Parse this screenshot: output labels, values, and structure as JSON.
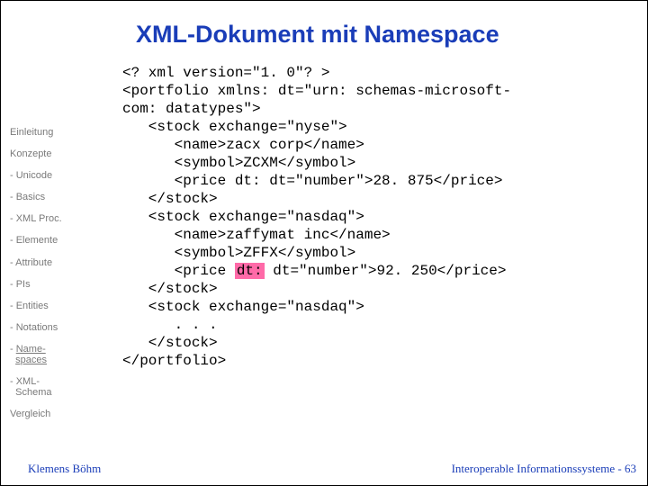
{
  "title": "XML-Dokument mit Namespace",
  "sidebar": {
    "items": [
      "Einleitung",
      "Konzepte",
      "- Unicode",
      "- Basics",
      "- XML Proc.",
      "- Elemente",
      "- Attribute",
      "- PIs",
      "- Entities",
      "- Notations"
    ],
    "active_prefix": "- ",
    "active_link_1": "Name-",
    "active_link_2": "spaces",
    "schema_1": "- XML-",
    "schema_2": "Schema",
    "last": "Vergleich"
  },
  "code": {
    "l1": "<? xml version=\"1. 0\"? >",
    "l2": "<portfolio xmlns: dt=\"urn: schemas-microsoft-",
    "l3": "com: datatypes\">",
    "l4": "   <stock exchange=\"nyse\">",
    "l5": "      <name>zacx corp</name>",
    "l6": "      <symbol>ZCXM</symbol>",
    "l7": "      <price dt: dt=\"number\">28. 875</price>",
    "l8": "   </stock>",
    "l9": "   <stock exchange=\"nasdaq\">",
    "l10": "      <name>zaffymat inc</name>",
    "l11": "      <symbol>ZFFX</symbol>",
    "l12a": "      <price ",
    "l12hl": "dt:",
    "l12b": " dt=\"number\">92. 250</price>",
    "l13": "   </stock>",
    "l14": "   <stock exchange=\"nasdaq\">",
    "l15": "      . . .",
    "l16": "   </stock>",
    "l17": "</portfolio>"
  },
  "footer": {
    "left": "Klemens Böhm",
    "right": "Interoperable Informationssysteme - 63"
  }
}
